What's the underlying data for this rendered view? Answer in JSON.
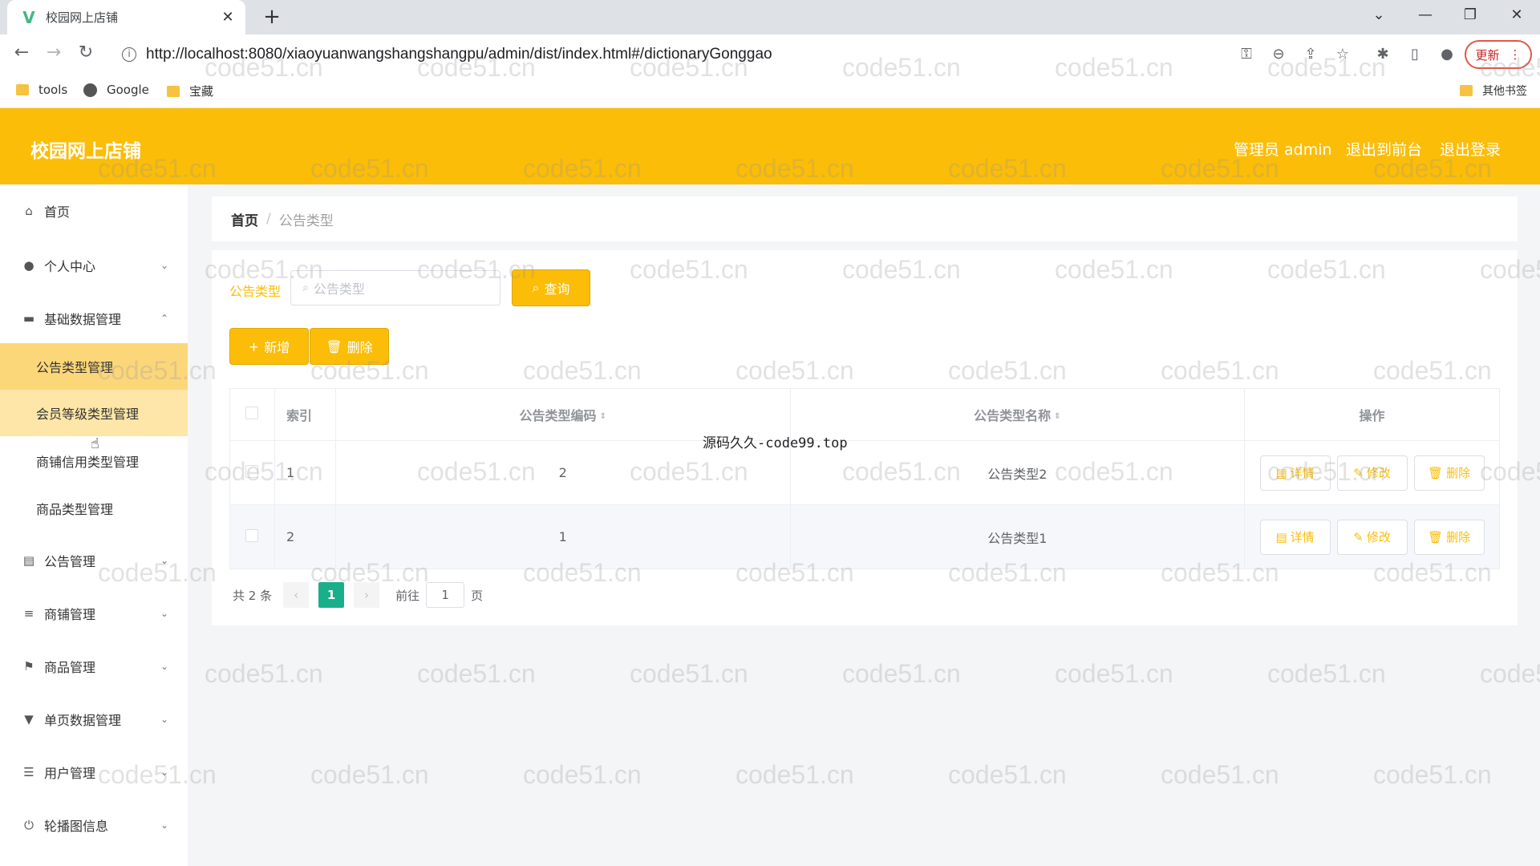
{
  "browser": {
    "tab_title": "校园网上店铺",
    "url": "http://localhost:8080/xiaoyuanwangshangshangpu/admin/dist/index.html#/dictionaryGonggao",
    "update_label": "更新",
    "bookmarks": [
      "tools",
      "Google",
      "宝藏"
    ],
    "other_bookmarks": "其他书签"
  },
  "header": {
    "title": "校园网上店铺",
    "admin_label": "管理员 admin",
    "to_front": "退出到前台",
    "logout": "退出登录",
    "accent_color": "#fbbd08"
  },
  "sidebar": {
    "items": [
      {
        "label": "首页",
        "icon": "home-icon"
      },
      {
        "label": "个人中心",
        "icon": "user-icon"
      },
      {
        "label": "基础数据管理",
        "icon": "briefcase-icon"
      },
      {
        "label": "公告管理",
        "icon": "clipboard-icon"
      },
      {
        "label": "商铺管理",
        "icon": "sliders-icon"
      },
      {
        "label": "商品管理",
        "icon": "flag-icon"
      },
      {
        "label": "单页数据管理",
        "icon": "sign-icon"
      },
      {
        "label": "用户管理",
        "icon": "list-icon"
      },
      {
        "label": "轮播图信息",
        "icon": "power-icon"
      }
    ],
    "sub_items": [
      "公告类型管理",
      "会员等级类型管理",
      "商铺信用类型管理",
      "商品类型管理"
    ]
  },
  "breadcrumb": {
    "home": "首页",
    "sep": "/",
    "current": "公告类型"
  },
  "search": {
    "label": "公告类型",
    "placeholder": "公告类型",
    "button": "查询"
  },
  "actions": {
    "add": "新增",
    "delete": "删除"
  },
  "table": {
    "headers": [
      "索引",
      "公告类型编码",
      "公告类型名称",
      "操作"
    ],
    "rows": [
      {
        "index": "1",
        "code": "2",
        "name": "公告类型2"
      },
      {
        "index": "2",
        "code": "1",
        "name": "公告类型1"
      }
    ],
    "op_labels": {
      "detail": "详情",
      "edit": "修改",
      "delete": "删除"
    }
  },
  "pager": {
    "total": "共 2 条",
    "page": "1",
    "goto": "前往",
    "goto_value": "1",
    "page_suffix": "页"
  },
  "overlay_text": "源码久久-code99.top",
  "watermark": "code51.cn"
}
